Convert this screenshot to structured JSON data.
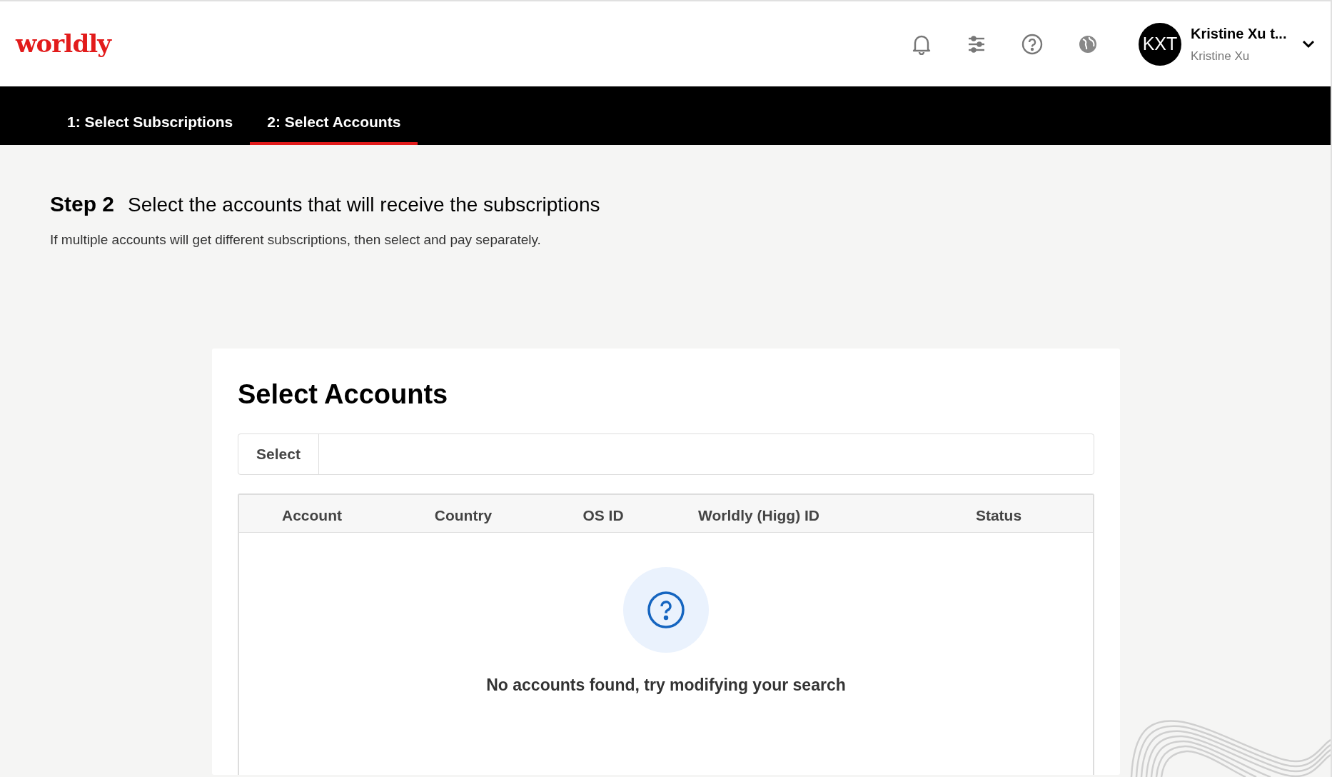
{
  "header": {
    "logo": "worldly",
    "user": {
      "initials": "KXT",
      "name": "Kristine Xu t...",
      "subtitle": "Kristine Xu"
    }
  },
  "tabs": [
    {
      "label": "1: Select Subscriptions",
      "selected": false
    },
    {
      "label": "2: Select Accounts",
      "selected": true
    }
  ],
  "step": {
    "label": "Step 2",
    "title": "Select the accounts that will receive the subscriptions",
    "description": "If multiple accounts will get different subscriptions, then select and pay separately."
  },
  "card": {
    "title": "Select Accounts",
    "select_label": "Select",
    "table": {
      "columns": [
        "Account",
        "Country",
        "OS ID",
        "Worldly (Higg) ID",
        "Status"
      ],
      "empty_message": "No accounts found, try modifying your search"
    }
  }
}
